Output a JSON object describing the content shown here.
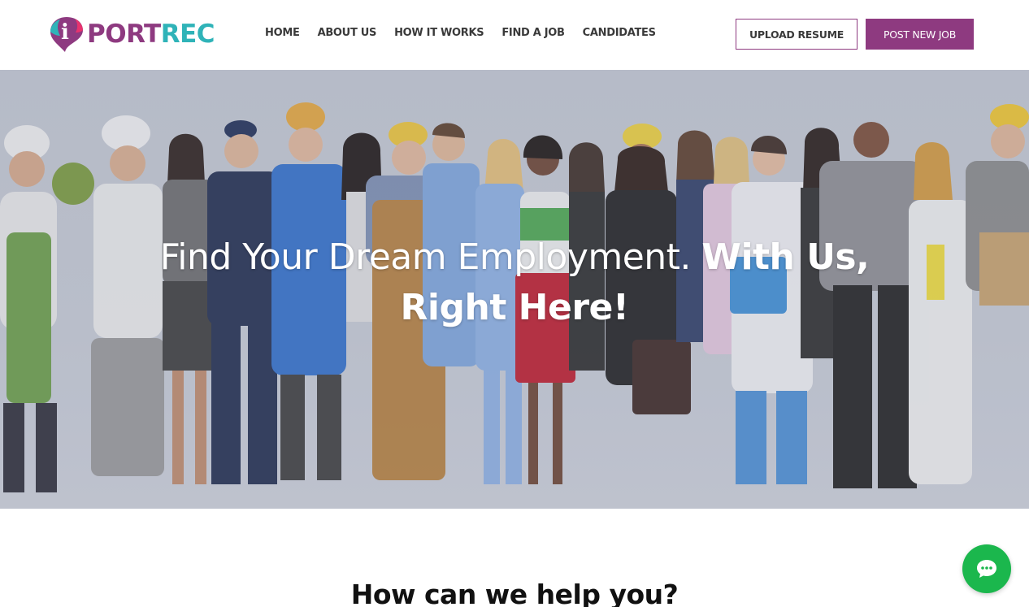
{
  "brand": {
    "name_part1": "PORT",
    "name_part2": "REC",
    "logo_letter": "i",
    "primary_color": "#8e3a80",
    "secondary_color": "#2fb3b8"
  },
  "nav": {
    "items": [
      {
        "label": "HOME"
      },
      {
        "label": "ABOUT US"
      },
      {
        "label": "HOW IT WORKS"
      },
      {
        "label": "FIND A JOB"
      },
      {
        "label": "CANDIDATES"
      }
    ]
  },
  "header_actions": {
    "upload_resume": "UPLOAD RESUME",
    "post_new_job": "POST NEW JOB"
  },
  "hero": {
    "line1_light": "Find Your Dream Employment. ",
    "line1_bold": "With Us,",
    "line2_bold": "Right Here!"
  },
  "section": {
    "title": "How can we help you?"
  },
  "chat": {
    "icon": "chat-bubble-icon",
    "color": "#1bb74d"
  }
}
